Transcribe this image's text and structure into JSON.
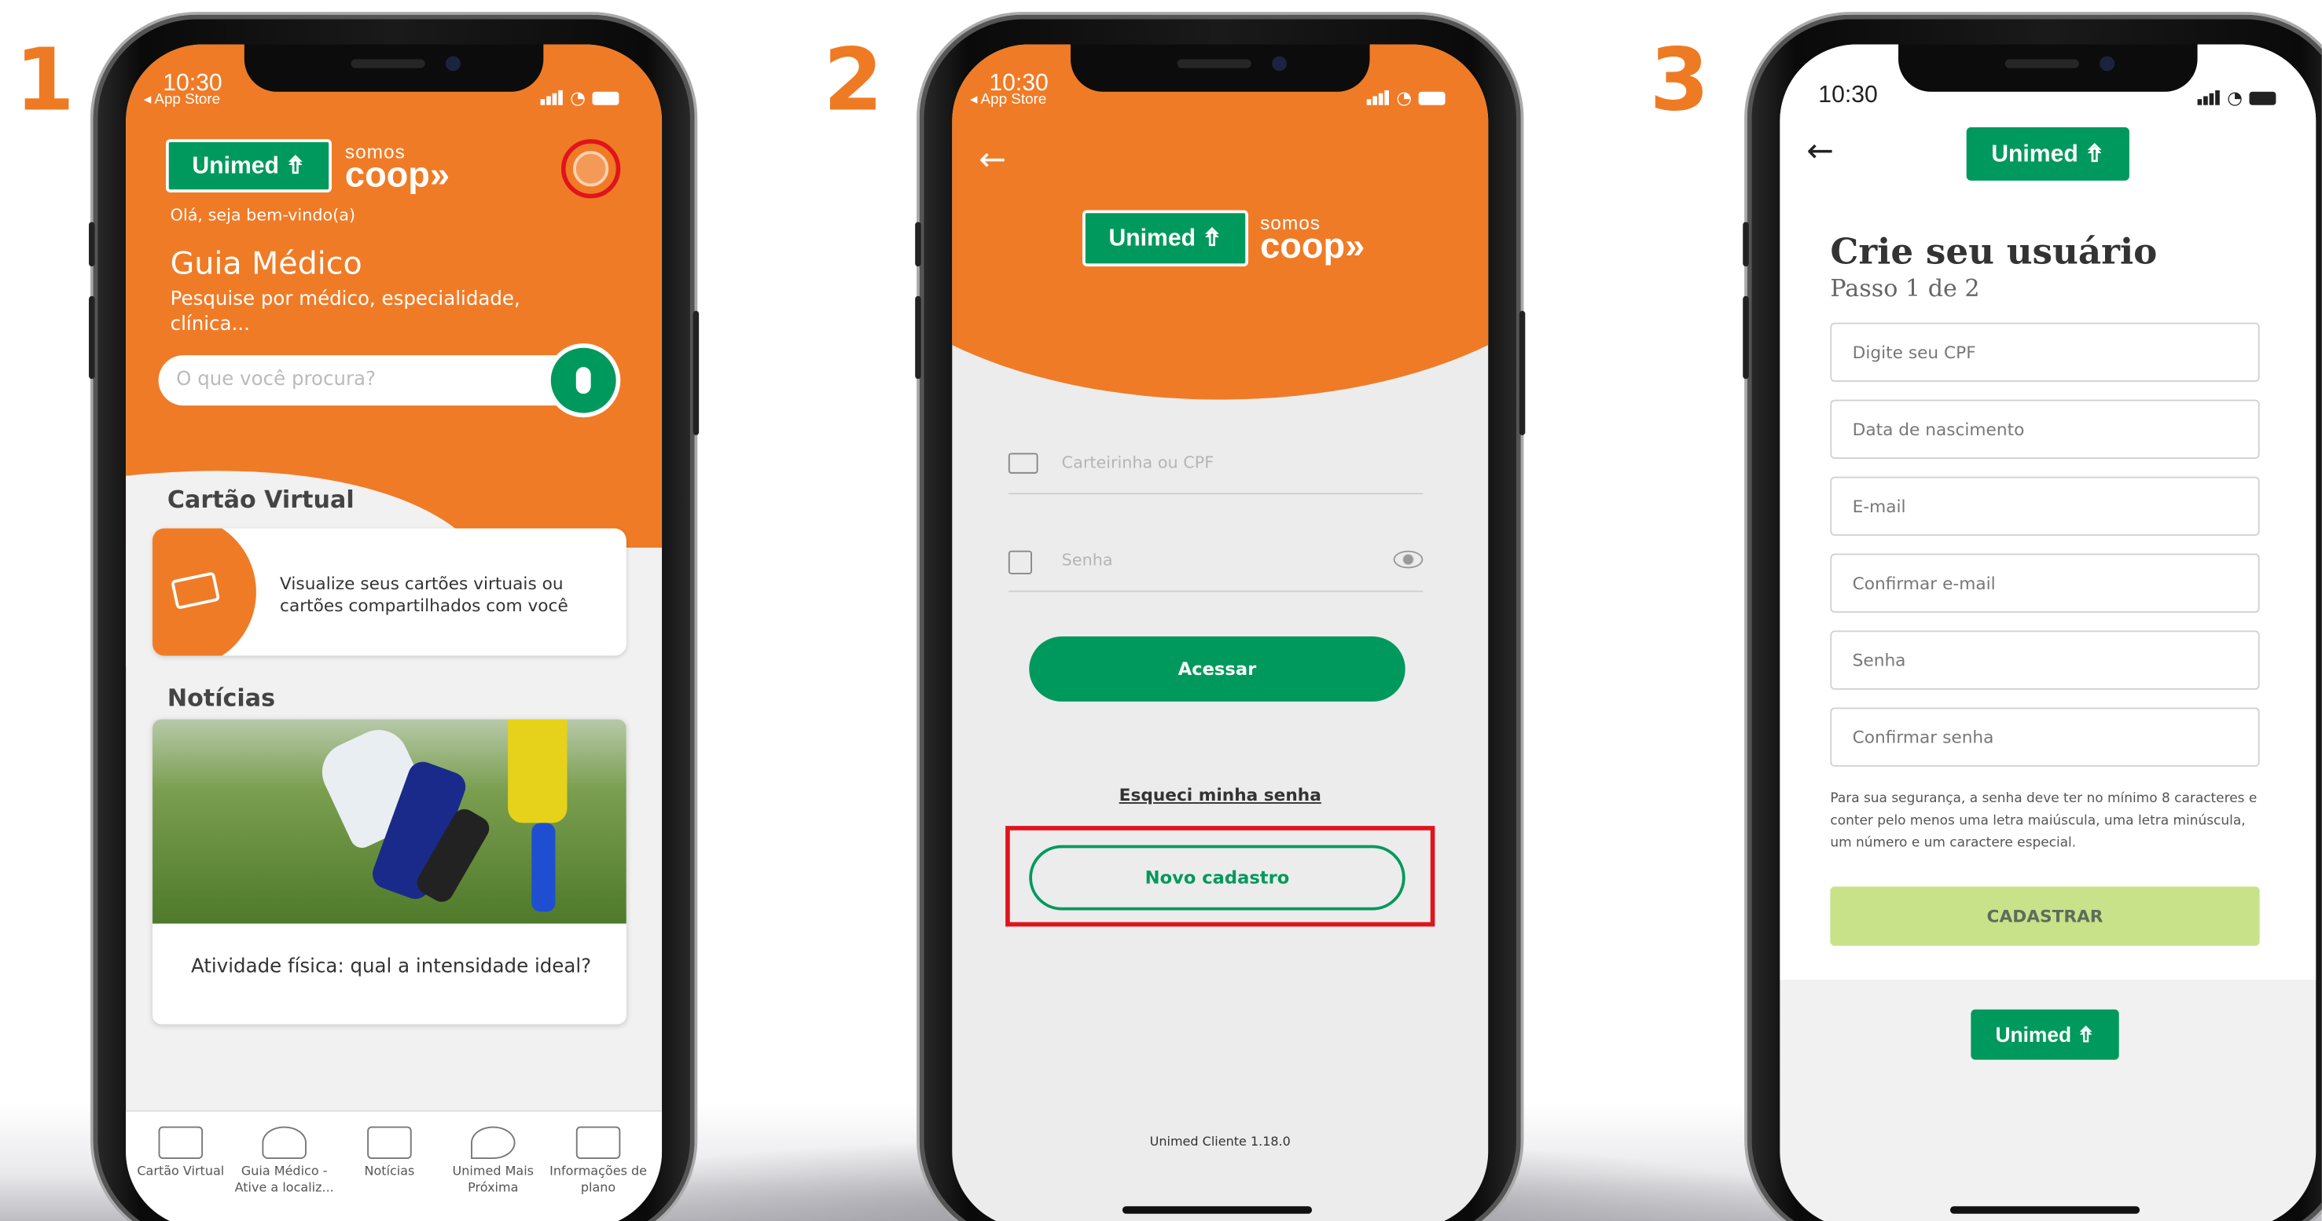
{
  "steps": [
    "1",
    "2",
    "3"
  ],
  "status": {
    "time": "10:30",
    "back_app": "◂ App Store"
  },
  "brand": {
    "unimed": "Unimed ⇮",
    "somos": "somos",
    "coop": "coop»",
    "green": "#00995d",
    "orange": "#f07b26"
  },
  "screen1": {
    "greeting": "Olá, seja bem-vindo(a)",
    "title": "Guia Médico",
    "subtitle": "Pesquise por médico, especialidade, clínica...",
    "search_placeholder": "O que você procura?",
    "section_card": "Cartão Virtual",
    "card_text": "Visualize seus cartões virtuais ou cartões compartilhados com você",
    "section_news": "Notícias",
    "news_title": "Atividade física: qual a intensidade ideal?",
    "tabs": [
      {
        "label": "Cartão Virtual",
        "icon": "card-icon"
      },
      {
        "label": "Guia Médico - Ative a localiz...",
        "icon": "doctor-icon"
      },
      {
        "label": "Notícias",
        "icon": "news-icon"
      },
      {
        "label": "Unimed Mais Próxima",
        "icon": "map-pin-icon"
      },
      {
        "label": "Informações de plano",
        "icon": "info-card-icon"
      }
    ]
  },
  "screen2": {
    "card_placeholder": "Carteirinha ou CPF",
    "password_placeholder": "Senha",
    "login_button": "Acessar",
    "forgot_link": "Esqueci minha senha",
    "new_account_button": "Novo cadastro",
    "version": "Unimed Cliente 1.18.0"
  },
  "screen3": {
    "title": "Crie seu usuário",
    "step": "Passo 1 de 2",
    "fields": [
      "Digite seu CPF",
      "Data de nascimento",
      "E-mail",
      "Confirmar e-mail",
      "Senha",
      "Confirmar senha"
    ],
    "hint": "Para sua segurança, a senha deve ter no mínimo 8 caracteres e conter pelo menos uma letra maiúscula, uma letra minúscula, um número e um caractere especial.",
    "register_button": "CADASTRAR",
    "footer_logo": "Unimed ⇮"
  }
}
